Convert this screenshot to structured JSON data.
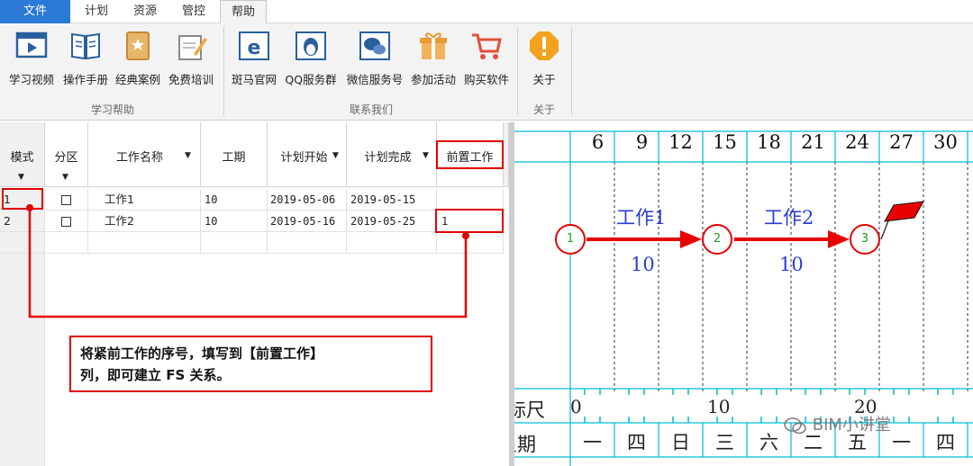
{
  "menu": {
    "tabs": [
      {
        "label": "文件"
      },
      {
        "label": "计划"
      },
      {
        "label": "资源"
      },
      {
        "label": "管控"
      },
      {
        "label": "帮助"
      }
    ]
  },
  "ribbon": {
    "buttons": [
      {
        "label": "学习视频",
        "icon": "video-icon"
      },
      {
        "label": "操作手册",
        "icon": "manual-icon"
      },
      {
        "label": "经典案例",
        "icon": "case-book-icon"
      },
      {
        "label": "免费培训",
        "icon": "training-icon"
      },
      {
        "label": "斑马官网",
        "icon": "browser-e-icon"
      },
      {
        "label": "QQ服务群",
        "icon": "qq-penguin-icon"
      },
      {
        "label": "微信服务号",
        "icon": "wechat-icon"
      },
      {
        "label": "参加活动",
        "icon": "gift-icon"
      },
      {
        "label": "购买软件",
        "icon": "cart-icon"
      },
      {
        "label": "关于",
        "icon": "info-icon"
      }
    ],
    "groups": [
      {
        "label": "学习帮助"
      },
      {
        "label": "联系我们"
      },
      {
        "label": "关于"
      }
    ]
  },
  "grid": {
    "headers": [
      {
        "label": "模式"
      },
      {
        "label": "分区"
      },
      {
        "label": "工作名称"
      },
      {
        "label": "工期"
      },
      {
        "label": "计划开始"
      },
      {
        "label": "计划完成"
      },
      {
        "label": "前置工作"
      }
    ],
    "rows": [
      {
        "num": "1",
        "name": "工作1",
        "duration": "10",
        "start": "2019-05-06",
        "end": "2019-05-15",
        "pred": ""
      },
      {
        "num": "2",
        "name": "工作2",
        "duration": "10",
        "start": "2019-05-16",
        "end": "2019-05-25",
        "pred": "1"
      }
    ]
  },
  "callout": {
    "line1": "将紧前工作的序号，填写到【前置工作】",
    "line2": "列，即可建立 FS 关系。"
  },
  "gantt": {
    "timescale": [
      "6",
      "9",
      "12",
      "15",
      "18",
      "21",
      "24",
      "27",
      "30"
    ],
    "tasks": [
      {
        "name": "工作1",
        "duration": "10"
      },
      {
        "name": "工作2",
        "duration": "10"
      }
    ],
    "nodes": [
      "1",
      "2",
      "3"
    ],
    "ruler_label": "标尺",
    "ruler_values": [
      "0",
      "10",
      "20"
    ],
    "weekday_label": "星期",
    "weekdays": [
      "一",
      "四",
      "日",
      "三",
      "六",
      "二",
      "五",
      "一",
      "四"
    ]
  },
  "watermark": "BIM小讲堂",
  "colors": {
    "accent": "#2b79d6",
    "highlight": "#e10000",
    "grid_cyan": "#00bcd4",
    "task_blue": "#2b3cd6"
  }
}
